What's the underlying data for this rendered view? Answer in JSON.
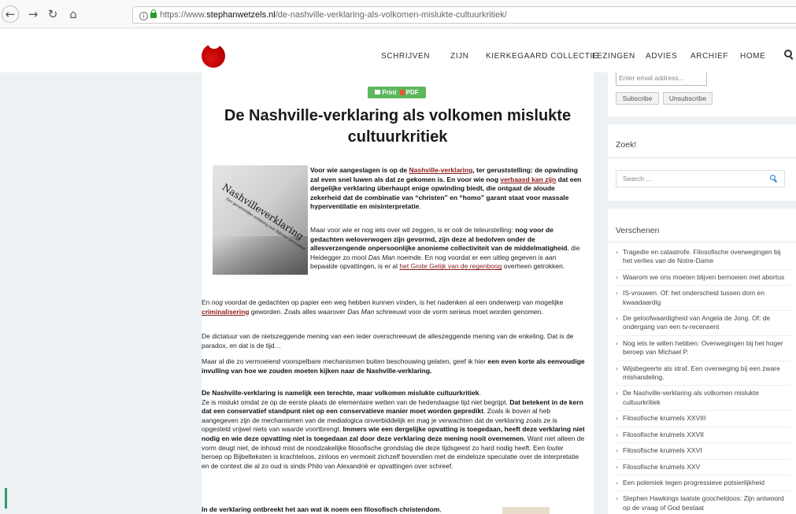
{
  "browser": {
    "url_prefix": "https://www.",
    "url_domain": "stephanwetzels.nl",
    "url_path": "/de-nashville-verklaring-als-volkomen-mislukte-cultuurkritiek/",
    "back_icon": "back-arrow",
    "forward_icon": "forward-arrow",
    "reload_icon": "reload",
    "home_icon": "home"
  },
  "nav": {
    "items": [
      "SCHRIJVEN",
      "ZIJN",
      "KIERKEGAARD COLLECTIE",
      "LEZINGEN",
      "ADVIES",
      "ARCHIEF",
      "HOME"
    ]
  },
  "article": {
    "print_pdf": "Print",
    "pdf_label": "PDF",
    "title_line1": "De Nashville-verklaring als volkomen mislukte",
    "title_line2": "cultuurkritiek",
    "thumb_word": "Nashvilleverklaring",
    "thumb_sub": "Een gezamenlijke verklaring over Bijbelse seksualiteit",
    "p1_a": "Voor wie aangeslagen is op de ",
    "p1_link1": "Nashville-verklaring",
    "p1_b": ", ter geruststelling: de opwinding zal even snel luwen als dat ze gekomen is. En voor wie nog ",
    "p1_link2": "verbaasd kan zijn",
    "p1_c": " dat een dergelijke verklaring überhaupt enige opwinding biedt, die ontgaat de aloude zekerheid dat de combinatie van “christen” en “homo” garant staat voor massale hyperventilatie en misinterpretatie",
    "p1_d": ".",
    "p2_a": "Maar voor wie er nog iets over wil zeggen, is er ook de teleurstelling: ",
    "p2_b": "nog voor de gedachten weloverwogen zijn gevormd, zijn deze al bedolven onder de allesverzengende onpersoonlijke anonieme collectiviteit van de middelmatigheid",
    "p2_c": ", die Heidegger zo mooi ",
    "p2_d": "Das Man",
    "p2_e": " noemde. En nog voordat er een uitleg gegeven is aan bepaalde opvattingen, is er al ",
    "p2_link": "het Grote Gelijk van de regenboog",
    "p2_f": " overheen getrokken.",
    "p3_a": "En ",
    "p3_b": "nog",
    "p3_c": " voordat de gedachten op papier een weg hebben kunnen vinden, is het nadenken al een onderwerp van mogelijke ",
    "p3_link": "criminalisering",
    "p3_d": " geworden. Zoals alles waarover ",
    "p3_e": "Das Man",
    "p3_f": " schreeuwt voor de vorm serieus moet worden genomen.",
    "p4": "De dictatuur van de nietszeggende mening van een ieder overschreeuwt de alleszeggende mening van de enkeling. Dat is de paradox, en dat is de tijd…",
    "p5_a": "Maar al die zo vermoeiend voorspelbare mechanismen buiten beschouwing gelaten, geef ik hier ",
    "p5_b": "een even korte als eenvoudige invulling van hoe we zouden moeten kijken naar de Nashville-verklaring.",
    "p6_head": "De Nashville-verklaring is namelijk een terechte, maar volkomen mislukte cultuurkritiek",
    "p6_head_dot": ".",
    "p6_a": "Ze is mislukt omdat ze op de eerste plaats de elementaire wetten van de hedendaagse tijd niet begrijpt. ",
    "p6_b": "Dat betekent in de kern dat een conservatief standpunt niet op een conservatieve manier moet worden gepredikt",
    "p6_c": ". Zoals ik boven al heb aangegeven zijn de mechanismen van de medialogica onverbiddelijk en mag je verwachten dat de verklaring zoals ze is opgesteld vrijwel niets van waarde voortbrengt. ",
    "p6_d": "Immers wie een dergelijke opvatting is toegedaan, heeft deze verklaring niet nodig en wie deze opvatting niet is toegedaan zal door deze verklaring deze mening nooit overnemen.",
    "p6_e": " Want niet alleen de vorm deugt niet, de inhoud mist de noodzakelijke filosofische grondslag die deze tijdsgeest zo hard nodig heeft. Een ",
    "p6_f": "louter",
    "p6_g": " beroep op Bijbelteksten is krachteloos, zinloos en vermoeit zichzelf bovendien met de eindeloze speculatie over de interpretatie en de context die al zo oud is sinds Philo van Alexandrië er opvattingen over schreef.",
    "p7": "In de verklaring ontbreekt het aan wat ik noem een filosofisch christendom",
    "p7_comma": ","
  },
  "sidebar": {
    "email_placeholder": "Enter email address...",
    "subscribe": "Subscribe",
    "unsubscribe": "Unsubscribe",
    "search_title": "Zoek!",
    "search_placeholder": "Search ...",
    "recent_title": "Verschenen",
    "recent": [
      "Tragedie en catastrofe. Filosofische overwegingen bij het verlies van de Notre-Dame",
      "Waarom we ons moeten blijven bemoeien met abortus",
      "IS-vrouwen. Of: het onderscheid tussen dom en kwaadaardig",
      "De geloofwaardigheid van Angela de Jong. Of: de ondergang van een tv-recensent",
      "Nog iets te willen hebben: Overwegingen bij het hoger beroep van Michael P.",
      "Wijsbegeerte als straf. Een overweging bij een zware mishandeling.",
      "De Nashville-verklaring als volkomen mislukte cultuurkritiek",
      "Filosofische kruimels XXVIII",
      "Filosofische kruimels XXVII",
      "Filosofische kruimels XXVI",
      "Filosofische kruimels XXV",
      "Een polemiek tegen progressieve potsierlijkheid",
      "Stephen Hawkings laatste goocheldoos: Zijn antwoord op de vraag of God bestaat"
    ]
  },
  "colors": {
    "accent_link": "#8b1a1a",
    "print_button": "#5cb85c",
    "search_icon": "#1e7bd6",
    "page_bg": "#edf1f3"
  }
}
